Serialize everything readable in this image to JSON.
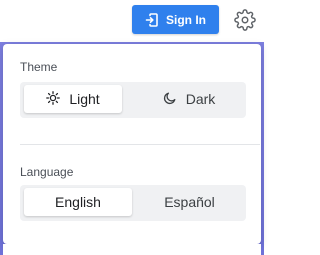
{
  "header": {
    "sign_in_label": "Sign In",
    "sign_in_icon": "sign-in-icon",
    "settings_icon": "gear-icon"
  },
  "settings_panel": {
    "theme": {
      "label": "Theme",
      "options": [
        {
          "label": "Light",
          "icon": "sun-icon",
          "selected": true
        },
        {
          "label": "Dark",
          "icon": "moon-icon",
          "selected": false
        }
      ]
    },
    "language": {
      "label": "Language",
      "options": [
        {
          "label": "English",
          "selected": true
        },
        {
          "label": "Español",
          "selected": false
        }
      ]
    }
  },
  "colors": {
    "primary": "#2f80ed",
    "backdrop": "#7174dd",
    "segment_bg": "#f0f1f3"
  }
}
